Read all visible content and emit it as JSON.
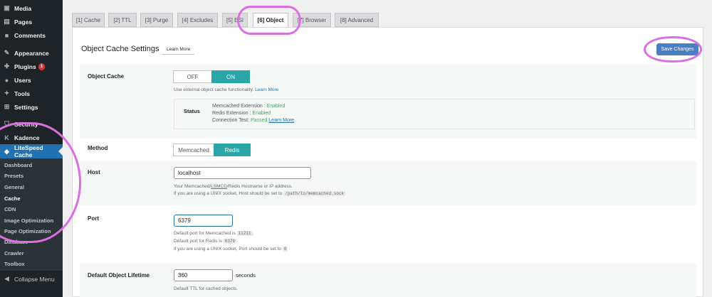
{
  "sidebar": {
    "items": [
      {
        "label": "Media",
        "icon": "media-icon"
      },
      {
        "label": "Pages",
        "icon": "pages-icon"
      },
      {
        "label": "Comments",
        "icon": "comments-icon"
      },
      {
        "label": "Appearance",
        "icon": "appearance-icon"
      },
      {
        "label": "Plugins",
        "icon": "plugins-icon",
        "badge": "1"
      },
      {
        "label": "Users",
        "icon": "users-icon"
      },
      {
        "label": "Tools",
        "icon": "tools-icon"
      },
      {
        "label": "Settings",
        "icon": "settings-icon"
      },
      {
        "label": "Security",
        "icon": "security-icon"
      },
      {
        "label": "Kadence",
        "icon": "kadence-icon"
      },
      {
        "label": "LiteSpeed Cache",
        "icon": "litespeed-icon"
      }
    ],
    "submenu": [
      "Dashboard",
      "Presets",
      "General",
      "Cache",
      "CDN",
      "Image Optimization",
      "Page Optimization",
      "Database",
      "Crawler",
      "Toolbox"
    ],
    "collapse_label": "Collapse Menu"
  },
  "tabs": [
    "[1] Cache",
    "[2] TTL",
    "[3] Purge",
    "[4] Excludes",
    "[5] ESI",
    "[6] Object",
    "[7] Browser",
    "[8] Advanced"
  ],
  "header": {
    "title": "Object Cache Settings",
    "learn_more": "Learn More",
    "save_label": "Save Changes"
  },
  "object_cache": {
    "label": "Object Cache",
    "off": "OFF",
    "on": "ON",
    "desc": "Use external object cache functionality.",
    "desc_link": "Learn More",
    "status_label": "Status",
    "status_lines": [
      {
        "key": "Memcached Extension :",
        "value": "Enabled"
      },
      {
        "key": "Redis Extension :",
        "value": "Enabled"
      },
      {
        "key": "Connection Test:",
        "value": "Passed"
      }
    ],
    "status_link": "Learn More"
  },
  "method": {
    "label": "Method",
    "memcached": "Memcached",
    "redis": "Redis"
  },
  "host": {
    "label": "Host",
    "value": "localhost",
    "desc1_a": "Your Memcached/",
    "desc1_b": "LSMCD",
    "desc1_c": "/Redis Hostname or IP address.",
    "desc2": "If you are using a UNIX socket, Host should be set to",
    "desc2_code": "/path/to/memcached.sock"
  },
  "port": {
    "label": "Port",
    "value": "6379",
    "desc1": "Default port for Memcached is",
    "desc1_code": "11211",
    "desc2": "Default port for Redis is",
    "desc2_code": "6379",
    "desc3": "If you are using a UNIX socket, Port should be set to",
    "desc3_code": "0"
  },
  "lifetime": {
    "label": "Default Object Lifetime",
    "value": "360",
    "unit": "seconds",
    "desc": "Default TTL for cached objects."
  },
  "colors": {
    "accent": "#2ba5a7",
    "save": "#4a7fc1",
    "highlight": "#d96fe0",
    "sidebar": "#1d2327",
    "active": "#2271b1"
  }
}
